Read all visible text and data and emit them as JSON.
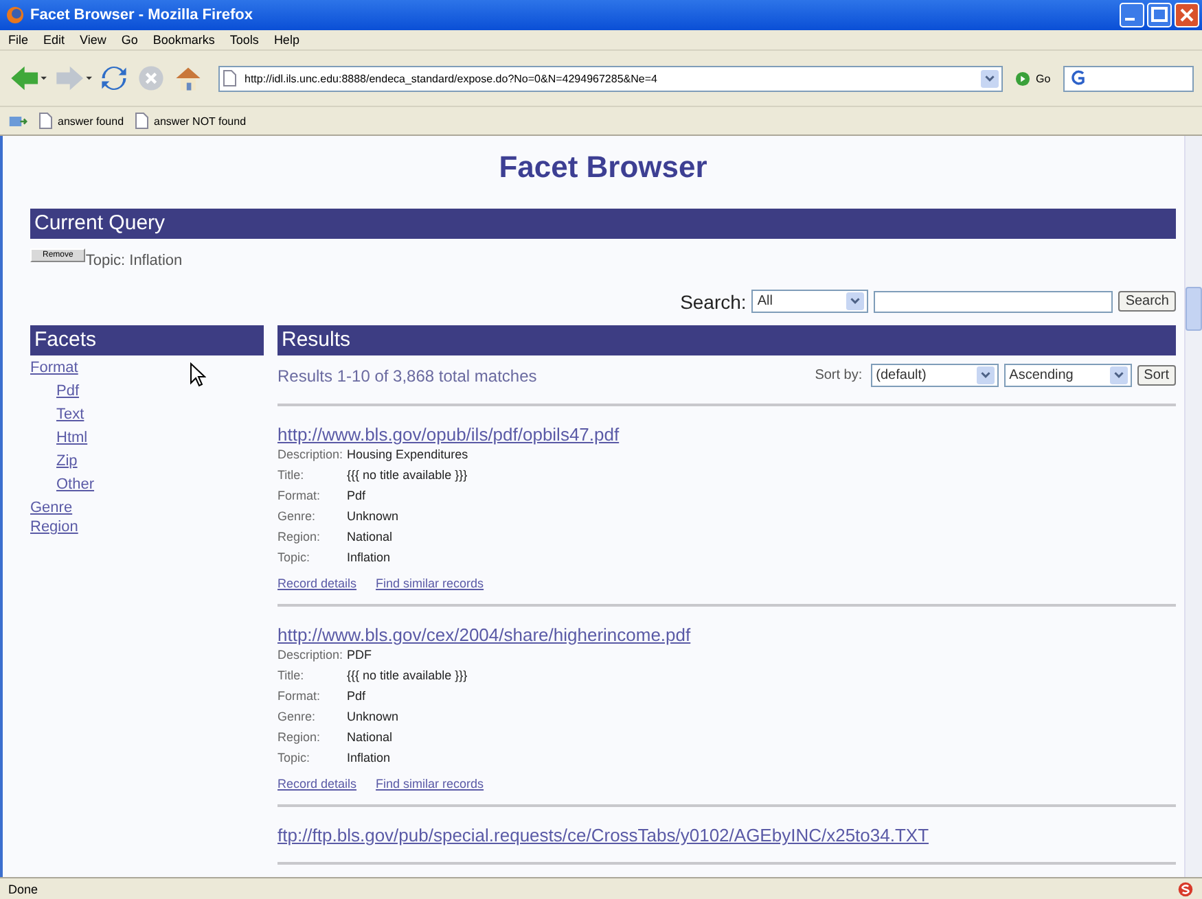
{
  "window": {
    "title": "Facet Browser - Mozilla Firefox"
  },
  "menu": [
    "File",
    "Edit",
    "View",
    "Go",
    "Bookmarks",
    "Tools",
    "Help"
  ],
  "address": {
    "value": "http://idl.ils.unc.edu:8888/endeca_standard/expose.do?No=0&N=4294967285&Ne=4"
  },
  "go_button": "Go",
  "bookmarks": [
    "answer found",
    "answer NOT found"
  ],
  "page": {
    "title": "Facet Browser",
    "current_query": {
      "heading": "Current Query",
      "remove_button": "Remove",
      "term": "Topic: Inflation"
    },
    "search": {
      "label": "Search:",
      "scope": "All",
      "button": "Search"
    },
    "facets": {
      "heading": "Facets",
      "items": [
        {
          "label": "Format",
          "children": [
            {
              "label": "Pdf"
            },
            {
              "label": "Text"
            },
            {
              "label": "Html"
            },
            {
              "label": "Zip"
            },
            {
              "label": "Other"
            }
          ]
        },
        {
          "label": "Genre"
        },
        {
          "label": "Region"
        }
      ]
    },
    "results": {
      "heading": "Results",
      "summary": "Results 1-10 of 3,868 total matches",
      "sort_label": "Sort by:",
      "sort_field": "(default)",
      "sort_order": "Ascending",
      "sort_button": "Sort",
      "items": [
        {
          "url": "http://www.bls.gov/opub/ils/pdf/opbils47.pdf",
          "fields": [
            {
              "label": "Description:",
              "value": "Housing Expenditures"
            },
            {
              "label": "Title:",
              "value": "{{{ no title available }}}"
            },
            {
              "label": "Format:",
              "value": "Pdf"
            },
            {
              "label": "Genre:",
              "value": "Unknown"
            },
            {
              "label": "Region:",
              "value": "National"
            },
            {
              "label": "Topic:",
              "value": "Inflation"
            }
          ],
          "links": [
            "Record details",
            "Find similar records"
          ]
        },
        {
          "url": "http://www.bls.gov/cex/2004/share/higherincome.pdf",
          "fields": [
            {
              "label": "Description:",
              "value": "PDF"
            },
            {
              "label": "Title:",
              "value": "{{{ no title available }}}"
            },
            {
              "label": "Format:",
              "value": "Pdf"
            },
            {
              "label": "Genre:",
              "value": "Unknown"
            },
            {
              "label": "Region:",
              "value": "National"
            },
            {
              "label": "Topic:",
              "value": "Inflation"
            }
          ],
          "links": [
            "Record details",
            "Find similar records"
          ]
        },
        {
          "url": "ftp://ftp.bls.gov/pub/special.requests/ce/CrossTabs/y0102/AGEbyINC/x25to34.TXT"
        }
      ]
    }
  },
  "status_bar": {
    "text": "Done"
  }
}
